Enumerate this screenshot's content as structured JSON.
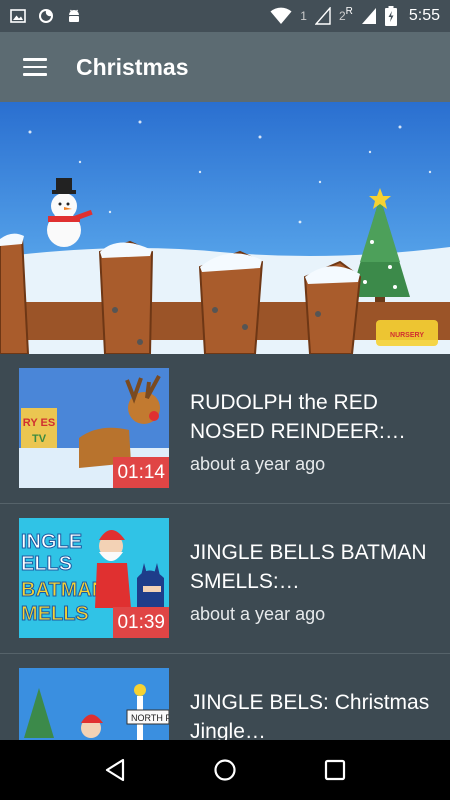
{
  "status_bar": {
    "time": "5:55",
    "sim1_label": "1",
    "sim2_label": "2",
    "roaming_label": "R",
    "icons": [
      "image-icon",
      "firefox-icon",
      "android-icon",
      "wifi-icon",
      "signal-icon",
      "battery-icon"
    ]
  },
  "app_bar": {
    "title": "Christmas",
    "menu_icon": "hamburger-menu-icon"
  },
  "hero": {
    "badge_text": "NURSERY RHYMES TV"
  },
  "videos": [
    {
      "title": "RUDOLPH the RED NOSED REINDEER:…",
      "time": "about a year ago",
      "duration": "01:14",
      "thumb_text": "RY ES TV"
    },
    {
      "title": "JINGLE BELLS BATMAN SMELLS:…",
      "time": "about a year ago",
      "duration": "01:39",
      "thumb_line1": "INGLE",
      "thumb_line2": "ELLS",
      "thumb_line3": "BATMAN",
      "thumb_line4": "MELLS"
    },
    {
      "title": "JINGLE BELS: Christmas Jingle…",
      "time": "",
      "duration": "",
      "thumb_sign": "NORTH P"
    }
  ],
  "nav_bar": {
    "icons": [
      "back-icon",
      "home-icon",
      "recents-icon"
    ]
  },
  "colors": {
    "status_bar": "#434f57",
    "app_bar": "#5c6b72",
    "list_bg": "#3d4a52",
    "duration_badge": "#e04545"
  }
}
